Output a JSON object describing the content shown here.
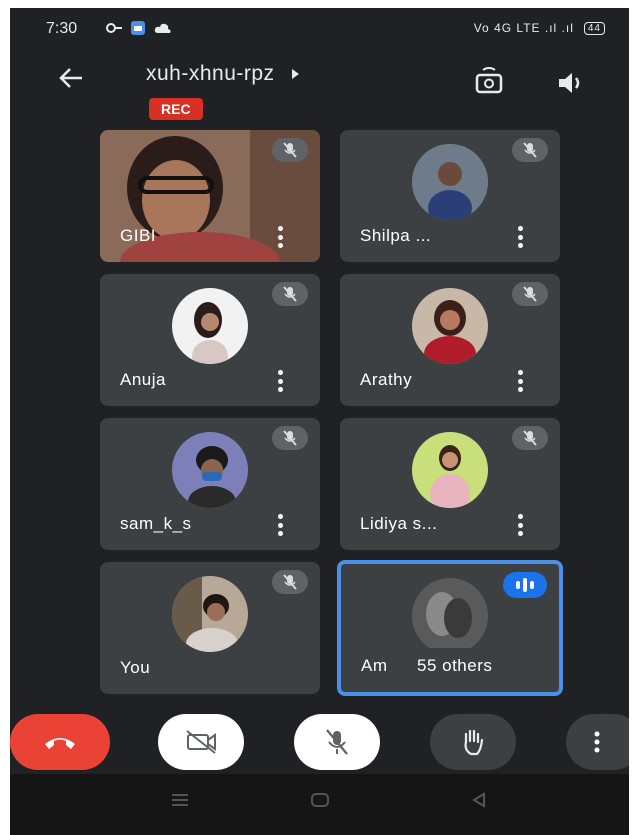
{
  "status_bar": {
    "time": "7:30",
    "signal_text": "Vo 4G LTE .ıl .ıl",
    "battery": "44"
  },
  "header": {
    "meeting_code": "xuh-xhnu-rpz",
    "recording_badge": "REC",
    "icons": [
      "back-arrow-icon",
      "switch-camera-icon",
      "speaker-icon"
    ]
  },
  "participants": [
    {
      "name": "GIBI",
      "video": true
    },
    {
      "name": "Shilpa ...",
      "video": false
    },
    {
      "name": "Anuja",
      "video": false
    },
    {
      "name": "Arathy",
      "video": false
    },
    {
      "name": "sam_k_s",
      "video": false
    },
    {
      "name": "Lidiya s...",
      "video": false
    },
    {
      "name": "You",
      "video": false
    },
    {
      "name": "Am",
      "video": false,
      "speaking": true
    }
  ],
  "others_label": "55 others",
  "controls": [
    "end-call",
    "camera-off",
    "mic-off",
    "raise-hand",
    "more-options"
  ],
  "colors": {
    "background": "#202124",
    "tile": "#3c4043",
    "end_call": "#ea4335",
    "rec": "#d93025",
    "active_border": "#4a8fe8"
  }
}
